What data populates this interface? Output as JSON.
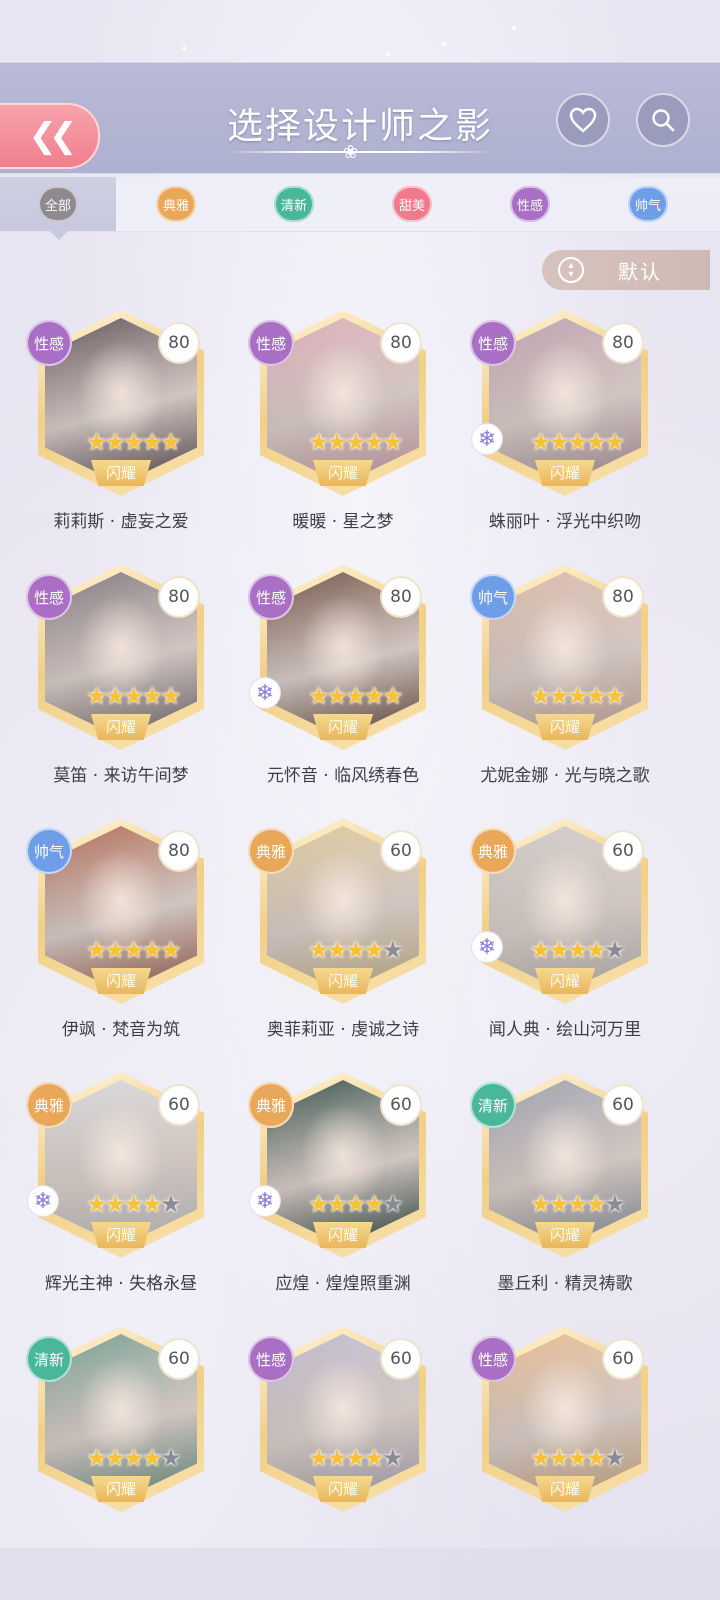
{
  "header": {
    "title": "选择设计师之影",
    "back_icon": "double-chevron-left-icon",
    "heart_icon": "heart-icon",
    "search_icon": "search-icon"
  },
  "tabs": [
    {
      "label": "全部",
      "color": "#8f8a90",
      "active": true
    },
    {
      "label": "典雅",
      "color": "#e9a75a",
      "active": false
    },
    {
      "label": "清新",
      "color": "#4bb79a",
      "active": false
    },
    {
      "label": "甜美",
      "color": "#f07a8c",
      "active": false
    },
    {
      "label": "性感",
      "color": "#a86fc4",
      "active": false
    },
    {
      "label": "帅气",
      "color": "#6f9ee8",
      "active": false
    }
  ],
  "sort": {
    "label": "默认",
    "icon": "sort-arrows-icon"
  },
  "banner_text": "闪耀",
  "cards": [
    {
      "name": "莉莉斯 · 虚妄之爱",
      "type": "性感",
      "level": "80",
      "stars": 5,
      "snowflake": false,
      "tint": "#6b5a63"
    },
    {
      "name": "暖暖 · 星之梦",
      "type": "性感",
      "level": "80",
      "stars": 5,
      "snowflake": false,
      "tint": "#e8b6c2"
    },
    {
      "name": "蛛丽叶 · 浮光中织吻",
      "type": "性感",
      "level": "80",
      "stars": 5,
      "snowflake": true,
      "tint": "#c7a9b8"
    },
    {
      "name": "莫笛 · 来访午间梦",
      "type": "性感",
      "level": "80",
      "stars": 5,
      "snowflake": false,
      "tint": "#8a7e86"
    },
    {
      "name": "元怀音 · 临风绣春色",
      "type": "性感",
      "level": "80",
      "stars": 5,
      "snowflake": true,
      "tint": "#7a5a4e"
    },
    {
      "name": "尤妮金娜 · 光与晓之歌",
      "type": "帅气",
      "level": "80",
      "stars": 5,
      "snowflake": false,
      "tint": "#e6c3b3"
    },
    {
      "name": "伊飒 · 梵音为筑",
      "type": "帅气",
      "level": "80",
      "stars": 5,
      "snowflake": false,
      "tint": "#b9725e"
    },
    {
      "name": "奥菲莉亚 · 虔诚之诗",
      "type": "典雅",
      "level": "60",
      "stars": 4,
      "snowflake": false,
      "tint": "#e6d2a4"
    },
    {
      "name": "闻人典 · 绘山河万里",
      "type": "典雅",
      "level": "60",
      "stars": 4,
      "snowflake": true,
      "tint": "#d8d6d1"
    },
    {
      "name": "辉光主神 · 失格永昼",
      "type": "典雅",
      "level": "60",
      "stars": 4,
      "snowflake": true,
      "tint": "#e0e2e6"
    },
    {
      "name": "应煌 · 煌煌照重渊",
      "type": "典雅",
      "level": "60",
      "stars": 4,
      "snowflake": true,
      "tint": "#3f5a54"
    },
    {
      "name": "墨丘利 · 精灵祷歌",
      "type": "清新",
      "level": "60",
      "stars": 4,
      "snowflake": false,
      "tint": "#a5aab8"
    },
    {
      "name": "",
      "type": "清新",
      "level": "60",
      "stars": 4,
      "snowflake": false,
      "tint": "#7ea79c"
    },
    {
      "name": "",
      "type": "性感",
      "level": "60",
      "stars": 4,
      "snowflake": false,
      "tint": "#c9c4d8"
    },
    {
      "name": "",
      "type": "性感",
      "level": "60",
      "stars": 4,
      "snowflake": false,
      "tint": "#f0c59a"
    }
  ],
  "type_colors": {
    "性感": "#a86fc4",
    "帅气": "#6f9ee8",
    "典雅": "#e9a75a",
    "清新": "#4bb79a",
    "甜美": "#f07a8c"
  },
  "snowflake_icon": "snowflake-icon",
  "star_icon": "star-icon"
}
